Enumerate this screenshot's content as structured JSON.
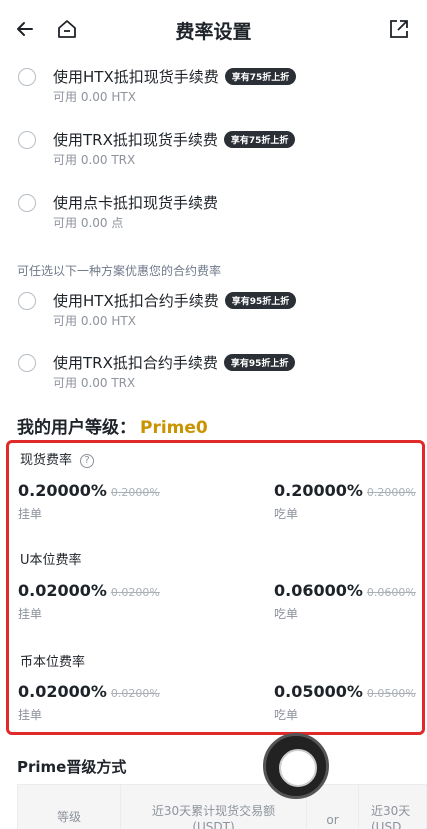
{
  "header": {
    "title": "费率设置"
  },
  "spot_options": [
    {
      "label": "使用HTX抵扣现货手续费",
      "badge": "享有75折上折",
      "sub": "可用 0.00 HTX"
    },
    {
      "label": "使用TRX抵扣现货手续费",
      "badge": "享有75折上折",
      "sub": "可用 0.00 TRX"
    },
    {
      "label": "使用点卡抵扣现货手续费",
      "badge": "",
      "sub": "可用 0.00 点"
    }
  ],
  "contract_note": "可任选以下一种方案优惠您的合约费率",
  "contract_options": [
    {
      "label": "使用HTX抵扣合约手续费",
      "badge": "享有95折上折",
      "sub": "可用 0.00 HTX"
    },
    {
      "label": "使用TRX抵扣合约手续费",
      "badge": "享有95折上折",
      "sub": "可用 0.00 TRX"
    }
  ],
  "user_level": {
    "label": "我的用户等级：",
    "value": "Prime0"
  },
  "fees": [
    {
      "title": "现货费率",
      "has_help": true,
      "maker": "0.20000%",
      "maker_old": "0.2000%",
      "maker_label": "挂单",
      "taker": "0.20000%",
      "taker_old": "0.2000%",
      "taker_label": "吃单"
    },
    {
      "title": "U本位费率",
      "has_help": false,
      "maker": "0.02000%",
      "maker_old": "0.0200%",
      "maker_label": "挂单",
      "taker": "0.06000%",
      "taker_old": "0.0600%",
      "taker_label": "吃单"
    },
    {
      "title": "币本位费率",
      "has_help": false,
      "maker": "0.02000%",
      "maker_old": "0.0200%",
      "maker_label": "挂单",
      "taker": "0.05000%",
      "taker_old": "0.0500%",
      "taker_label": "吃单"
    }
  ],
  "help_glyph": "?",
  "prime": {
    "title": "Prime晋级方式",
    "table": {
      "col1": "等级",
      "col2_line1": "近30天累计现货交易额",
      "col2_line2": "(USDT)",
      "col3": "or",
      "col4_line1": "近30天",
      "col4_line2": "(USD"
    }
  },
  "colors": {
    "accent_gold": "#c99400",
    "highlight_red": "#e02a2a",
    "badge_bg": "#2b2f36"
  }
}
